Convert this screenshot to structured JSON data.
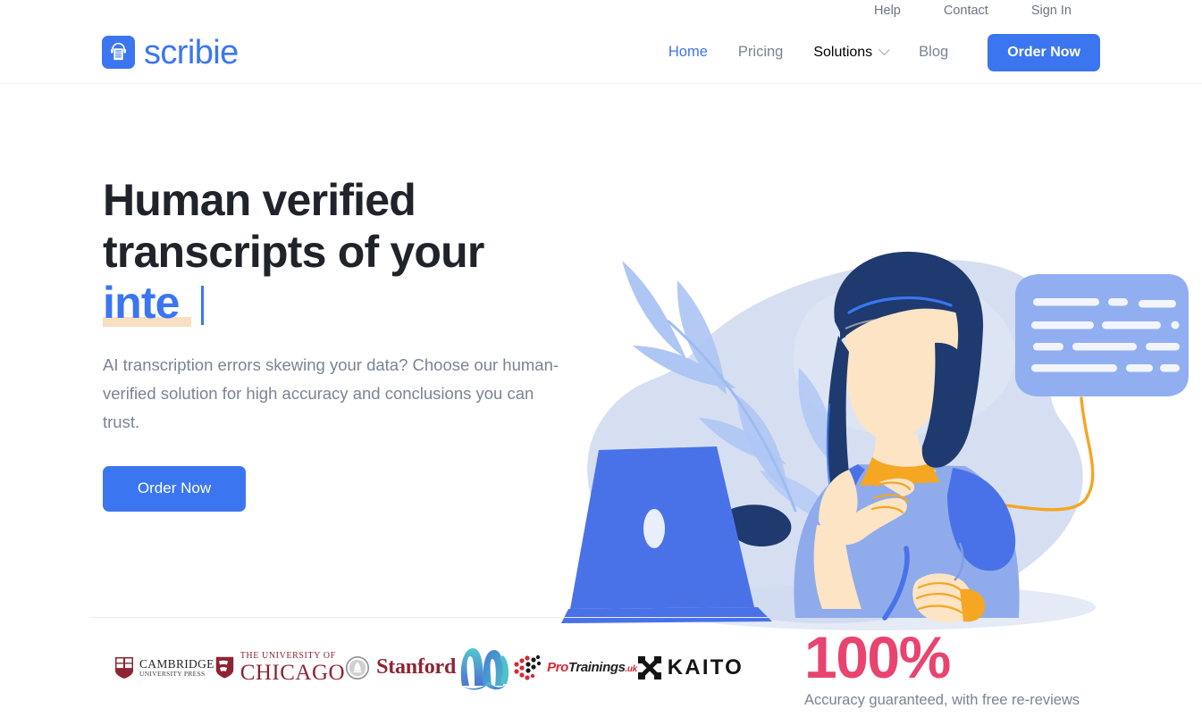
{
  "topbar": {
    "links": [
      {
        "label": "Help"
      },
      {
        "label": "Contact"
      },
      {
        "label": "Sign In"
      }
    ]
  },
  "header": {
    "brand": {
      "name": "scribie",
      "icon": "document-headphones-icon",
      "color": "#3b76f0"
    },
    "nav": [
      {
        "label": "Home",
        "active": true
      },
      {
        "label": "Pricing",
        "active": false
      },
      {
        "label": "Solutions",
        "active": false,
        "icon": "chevron-down-icon",
        "has_dropdown": true
      },
      {
        "label": "Blog",
        "active": false
      }
    ],
    "cta": {
      "label": "Order Now"
    }
  },
  "hero": {
    "title_line1": "Human verified",
    "title_line2": "transcripts of your",
    "typed_word": "inte",
    "typed_color": "#3b76f0",
    "highlight_color": "#f9dfc2",
    "subtitle": "AI transcription errors skewing your data? Choose our human-verified solution for high accuracy and conclusions you can trust.",
    "cta": {
      "label": "Order Now"
    },
    "illustration": {
      "name": "woman-at-laptop-with-speech-bubble-illustration",
      "colors": {
        "blob": "#d6dff2",
        "laptop": "#4a72e8",
        "shirt": "#8fabec",
        "sleeve": "#4a72e8",
        "hair": "#1e3a6e",
        "skin": "#fce4c4",
        "accent_orange": "#f5a623",
        "bubble": "#91aff0",
        "leaf": "#aec6f4"
      }
    }
  },
  "clients": [
    {
      "name": "Cambridge University Press",
      "line1": "CAMBRIDGE",
      "line2": "UNIVERSITY PRESS",
      "icon": "cambridge-crest-icon"
    },
    {
      "name": "The University of Chicago",
      "line1": "THE UNIVERSITY OF",
      "line2": "CHICAGO",
      "icon": "chicago-crest-icon"
    },
    {
      "name": "Stanford",
      "line1": "Stanford",
      "line2": "",
      "icon": "stanford-seal-icon"
    },
    {
      "name": "Wave",
      "line1": "",
      "line2": "",
      "icon": "wave-ribbon-logo-icon"
    },
    {
      "name": "ProTrainings.uk",
      "line1": "Pro",
      "line2": "Trainings",
      "line3": ".uk",
      "icon": "protrainings-dots-icon"
    },
    {
      "name": "KAITO",
      "line1": "KAITO",
      "line2": "",
      "icon": "kaito-mark-icon"
    }
  ],
  "stat": {
    "number": "100%",
    "label": "Accuracy guaranteed, with free re-reviews",
    "color": "#e8446f"
  }
}
